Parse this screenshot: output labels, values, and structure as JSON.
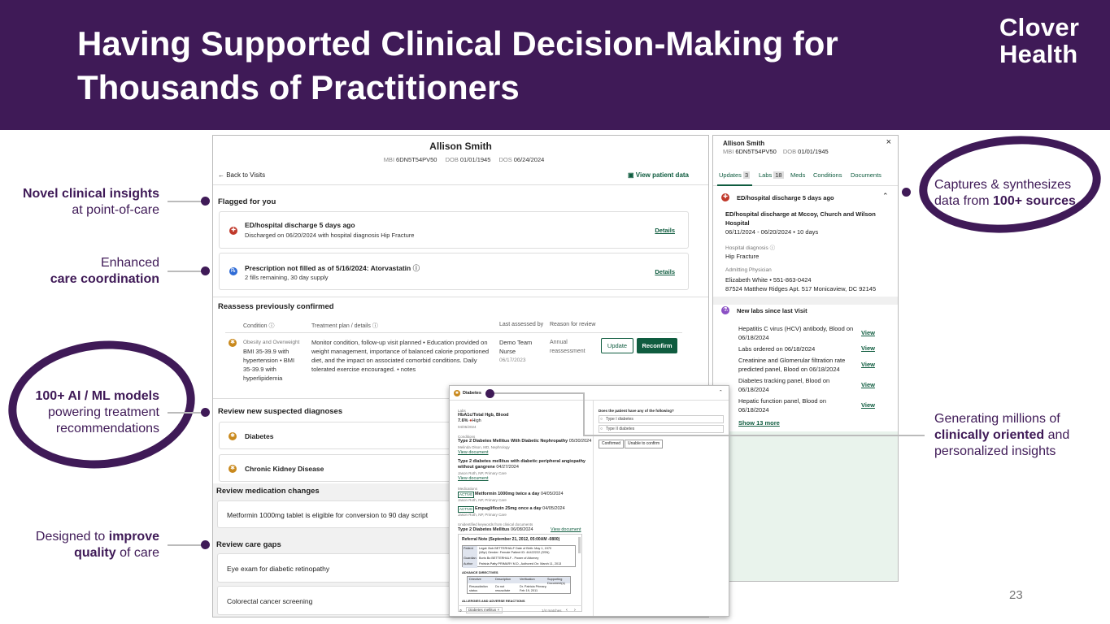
{
  "header": {
    "title": "Having Supported Clinical Decision-Making for Thousands of Practitioners",
    "logo_line1": "Clover",
    "logo_line2": "Health",
    "slide_number": "23"
  },
  "annotations": {
    "novel_1": "Novel clinical insights",
    "novel_2": "at point-of-care",
    "enh_1": "Enhanced",
    "enh_2": "care coordination",
    "ai_1": "100+ AI / ML models",
    "ai_2": "powering treatment",
    "ai_3": "recommendations",
    "design_pre": "Designed to ",
    "design_b1": "improve",
    "design_b2": "quality",
    "design_post": " of care",
    "cap_1": "Captures & synthesizes",
    "cap_2": "data from ",
    "cap_b": "100+ sources",
    "gen_1": "Generating millions of",
    "gen_b": "clinically oriented",
    "gen_2": " and",
    "gen_3": "personalized insights"
  },
  "patient": {
    "name": "Allison Smith",
    "mbi_label": "MBI",
    "mbi": "6DN5T54PV50",
    "dob_label": "DOB",
    "dob": "01/01/1945",
    "dos_label": "DOS",
    "dos": "06/24/2024",
    "back": "← Back to Visits",
    "view_patient": "View patient data"
  },
  "flagged": {
    "heading": "Flagged for you",
    "items": [
      {
        "title": "ED/hospital discharge 5 days ago",
        "sub": "Discharged on 06/20/2024 with hospital diagnosis Hip Fracture",
        "action": "Details"
      },
      {
        "title": "Prescription not filled as of 5/16/2024: Atorvastatin",
        "sub": "2 fills remaining, 30 day supply",
        "action": "Details"
      }
    ]
  },
  "reassess": {
    "heading": "Reassess previously confirmed",
    "columns": [
      "Condition",
      "Treatment plan / details",
      "Last assessed by",
      "Reason for review"
    ],
    "row": {
      "condition_label": "Obesity and Overweight",
      "condition_lines": [
        "BMI 35-39.9 with",
        "hypertension • BMI",
        "35-39.9 with",
        "hyperlipidemia"
      ],
      "plan_lines": [
        "Monitor condition, follow-up visit planned • Education provided on",
        "weight management, importance of balanced calorie proportioned",
        "diet, and the impact on associated comorbid conditions. Daily",
        "tolerated exercise encouraged. • notes"
      ],
      "assessor_1": "Demo Team",
      "assessor_2": "Nurse",
      "assessed_date": "06/17/2023",
      "reason_1": "Annual",
      "reason_2": "reassessment",
      "update": "Update",
      "reconfirm": "Reconfirm"
    }
  },
  "suspected": {
    "heading": "Review new suspected diagnoses",
    "items": [
      "Diabetes",
      "Chronic Kidney Disease"
    ]
  },
  "medication": {
    "heading": "Review medication changes",
    "item": "Metformin 1000mg tablet is eligible for conversion to 90 day script"
  },
  "care_gaps": {
    "heading": "Review care gaps",
    "items": [
      "Eye exam for diabetic retinopathy",
      "Colorectal cancer screening"
    ]
  },
  "side": {
    "name": "Allison Smith",
    "mbi_label": "MBI",
    "mbi": "6DN5T54PV50",
    "dob_label": "DOB",
    "dob": "01/01/1945",
    "close": "×",
    "tabs": {
      "updates": "Updates",
      "updates_count": "3",
      "labs": "Labs",
      "labs_count": "18",
      "meds": "Meds",
      "conditions": "Conditions",
      "documents": "Documents"
    },
    "ed_title": "ED/hospital discharge 5 days ago",
    "ed_place_1": "ED/hospital discharge at Mccoy, Church and Wilson",
    "ed_place_2": "Hospital",
    "ed_dates": "06/11/2024 - 06/20/2024 • 10 days",
    "diag_label": "Hospital diagnosis",
    "diag": "Hip Fracture",
    "phys_label": "Admitting Physician",
    "phys": "Elizabeth White • 551-863-0424",
    "address": "87524 Matthew Ridges Apt. 517 Monicaview, DC 92145",
    "labs_title": "New labs since last Visit",
    "labs": [
      {
        "l1": "Hepatitis C virus (HCV) antibody, Blood on",
        "l2": "06/18/2024",
        "view": "View"
      },
      {
        "l1": "Labs ordered on 06/18/2024",
        "l2": "",
        "view": "View"
      },
      {
        "l1": "Creatinine and Glomerular filtration rate",
        "l2": "predicted panel, Blood on 06/18/2024",
        "view": "View"
      },
      {
        "l1": "Diabetes tracking panel, Blood on",
        "l2": "06/18/2024",
        "view": "View"
      },
      {
        "l1": "Hepatic function panel, Blood on",
        "l2": "06/18/2024",
        "view": "View"
      }
    ],
    "show_more": "Show 13 more"
  },
  "popup": {
    "title": "Diabetes",
    "labs_label": "Labs",
    "lab_name": "HbA1c/Total Hgb, Blood",
    "lab_value": "7.6%",
    "lab_flag": "High",
    "lab_date": "04/05/2024",
    "conditions_label": "Conditions",
    "cond1": "Type 2 Diabetes Mellitus With Diabetic Nephropathy",
    "cond1_date": "05/30/2024",
    "cond1_by": "Melinda Olson, MD, Nephrology",
    "view_doc": "View document",
    "cond2_1": "Type 2 diabetes mellitus with diabetic peripheral angiopathy",
    "cond2_2": "without gangrene",
    "cond2_date": "04/27/2024",
    "cond2_by": "Jason Roth, NP, Primary Care",
    "meds_label": "Medications",
    "active": "ACTIVE",
    "med1": "Metformin 1000mg twice a day",
    "med1_date": "04/05/2024",
    "med1_by": "Jason Roth, NP, Primary Care",
    "med2": "Empagliflozin 25mg once a day",
    "med2_date": "04/05/2024",
    "med2_by": "Jason Roth, NP, Primary Care",
    "kw_label": "Unidentified keywords from clinical documents",
    "kw_item": "Type 2 Diabetes Mellitus",
    "kw_date": "06/08/2024",
    "question": "Does the patient have any of the following?",
    "opt1": "Type I diabetes",
    "opt2": "Type II diabetes",
    "confirmed": "Confirmed",
    "unable": "Unable to confirm",
    "ref_title": "Referral Note (September 21, 2012, 05:00AM -0800)",
    "ref_patient_k": "Patient",
    "ref_patient_v": "Legal: Bob BETTERHALF  Date of Birth: May 1, 1970",
    "ref_patient_v2": "(48yr)  Gender: Female  Patient ID: 44422222 (SSN)",
    "ref_guardian_k": "Guardian",
    "ref_guardian_v": "Boris Bo BETTERHALF - Power of Attorney",
    "ref_author_k": "Author",
    "ref_author_v": "Patrizia Patty PRIMARY M.D., Authored On: March 11, 2013",
    "adv": "ADVANCE DIRECTIVES",
    "adv_cols": [
      "Directive",
      "Description",
      "Verification",
      "Supporting Document(s)"
    ],
    "adv_row": [
      "Resuscitation status",
      "Do not resuscitate",
      "Dr. Patricia Primary, Feb 19, 2011",
      ""
    ],
    "allergies": "ALLERGIES AND ADVERSE REACTIONS",
    "search_chip": "Diabetes mellitus ×",
    "matches": "1/4 matches"
  }
}
